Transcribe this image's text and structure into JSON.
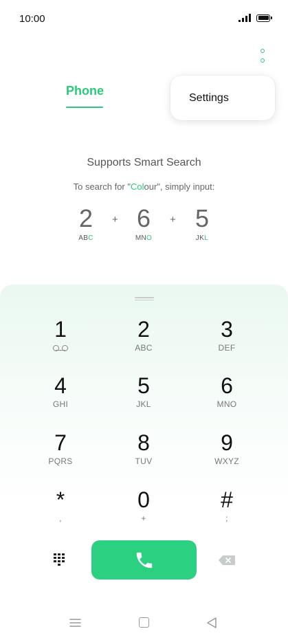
{
  "status_bar": {
    "time": "10:00"
  },
  "header": {
    "tab_phone": "Phone"
  },
  "popup_menu": {
    "items": [
      {
        "label": "Settings"
      }
    ]
  },
  "smart_search": {
    "title": "Supports Smart Search",
    "hint_prefix": "To search for \"",
    "hint_highlight": "Col",
    "hint_rest": "our",
    "hint_suffix": "\", simply input:",
    "examples": [
      {
        "digit": "2",
        "letters_plain": "AB",
        "letters_highlight": "C"
      },
      {
        "digit": "6",
        "letters_plain": "MN",
        "letters_highlight": "O"
      },
      {
        "digit": "5",
        "letters_plain": "JK",
        "letters_highlight": "L"
      }
    ],
    "plus": "+"
  },
  "keypad": [
    {
      "digit": "1",
      "letters": "",
      "icon": "voicemail-icon"
    },
    {
      "digit": "2",
      "letters": "ABC"
    },
    {
      "digit": "3",
      "letters": "DEF"
    },
    {
      "digit": "4",
      "letters": "GHI"
    },
    {
      "digit": "5",
      "letters": "JKL"
    },
    {
      "digit": "6",
      "letters": "MNO"
    },
    {
      "digit": "7",
      "letters": "PQRS"
    },
    {
      "digit": "8",
      "letters": "TUV"
    },
    {
      "digit": "9",
      "letters": "WXYZ"
    },
    {
      "digit": "*",
      "letters": ","
    },
    {
      "digit": "0",
      "letters": "+"
    },
    {
      "digit": "#",
      "letters": ";"
    }
  ],
  "actions": {
    "dialpad_icon": "dialpad-icon",
    "call_icon": "phone-icon",
    "backspace_icon": "backspace-icon"
  },
  "colors": {
    "accent": "#2bc97b",
    "call_button": "#2bd080"
  }
}
